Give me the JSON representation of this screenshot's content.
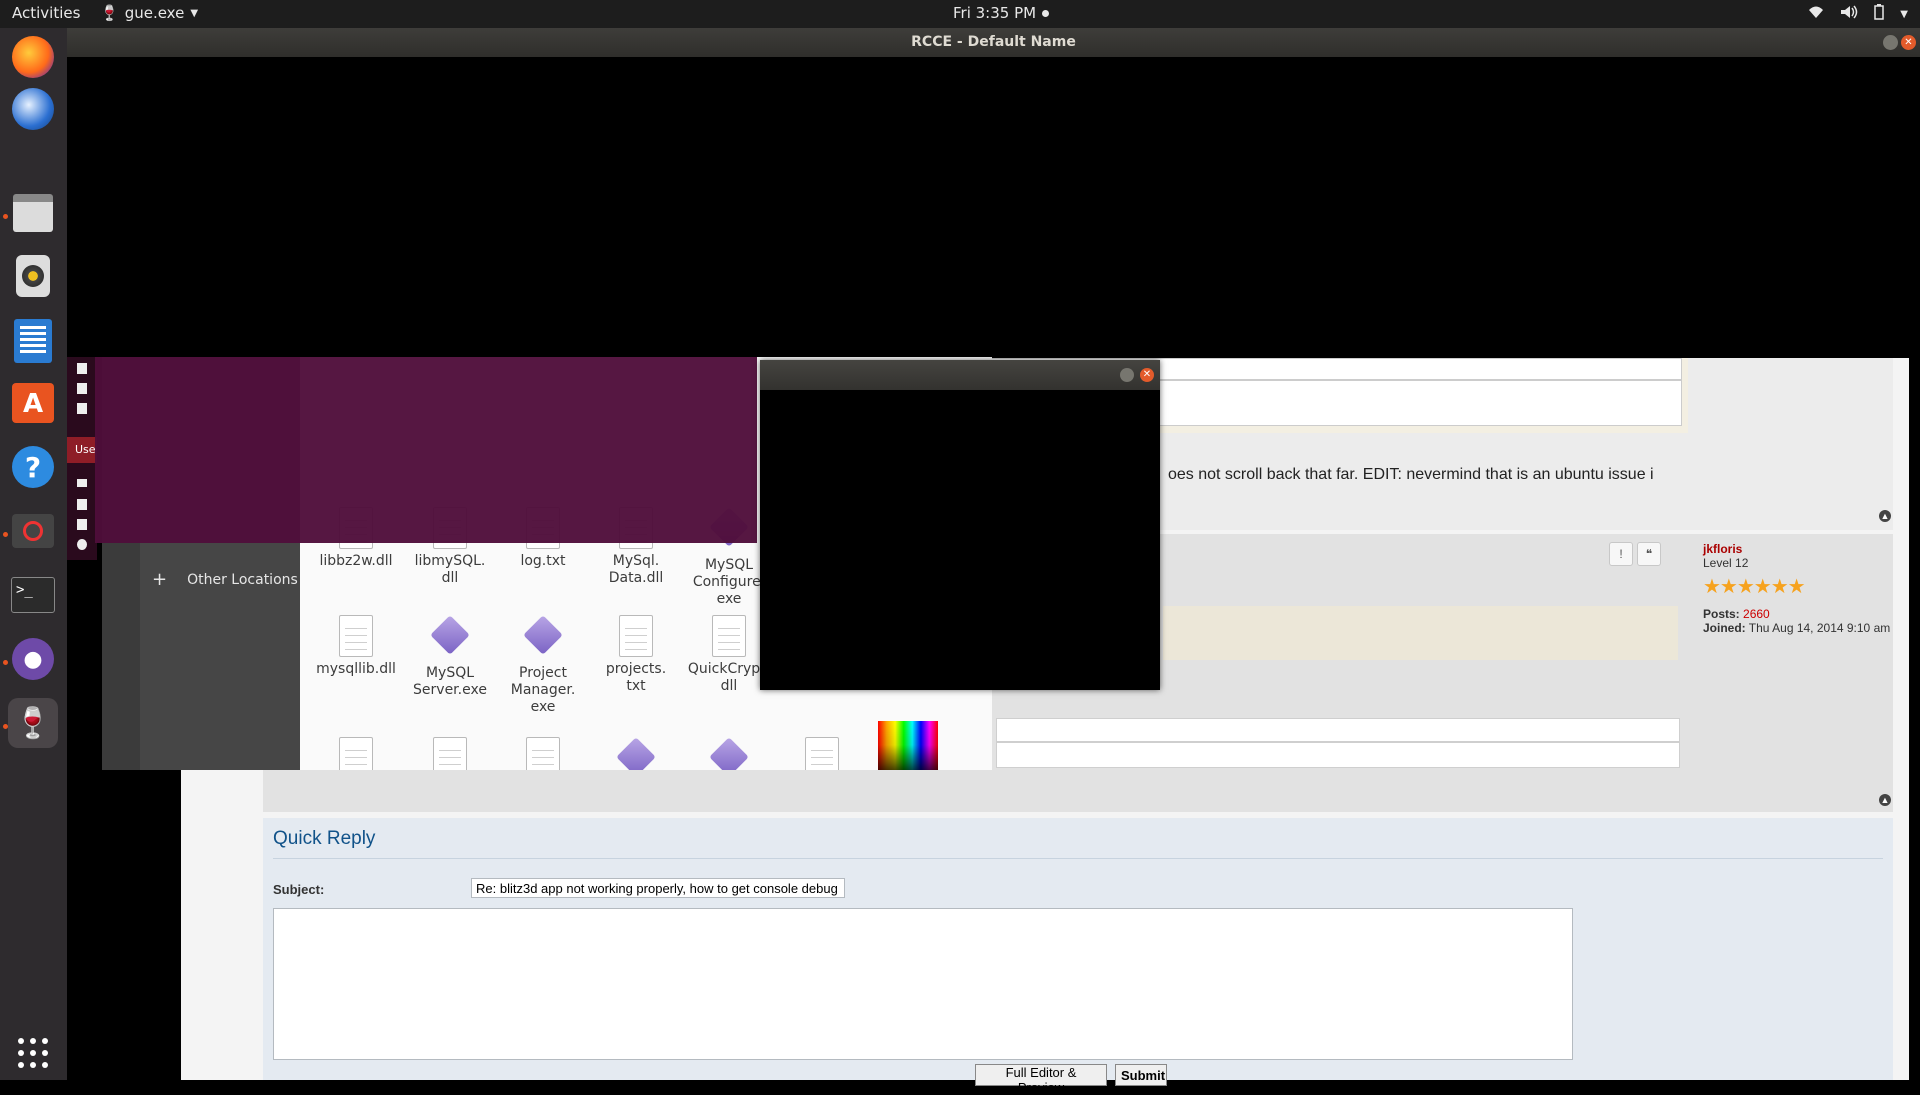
{
  "topbar": {
    "activities": "Activities",
    "app_name": "gue.exe",
    "clock": "Fri  3:35 PM"
  },
  "dock": {
    "items": [
      "firefox-icon",
      "thunderbird-icon",
      "files-icon",
      "rhythmbox-icon",
      "writer-icon",
      "software-icon",
      "help-icon",
      "blocked-icon",
      "terminal-icon",
      "github-icon",
      "wine-icon",
      "app-grid-icon"
    ]
  },
  "window": {
    "title": "RCCE - Default Name"
  },
  "forum": {
    "post1_text": "oes not scroll back that far. EDIT: nevermind that is an ubuntu issue i",
    "report_icon": "!",
    "quote_icon": "❝",
    "profile": {
      "username": "jkfloris",
      "rank": "Level 12",
      "posts_label": "Posts:",
      "posts": "2660",
      "joined_label": "Joined:",
      "joined": "Thu Aug 14, 2014 9:10 am"
    },
    "quick_reply": {
      "title": "Quick Reply",
      "subject_label": "Subject:",
      "subject_value": "Re: blitz3d app not working properly, how to get console debug",
      "full_editor_label": "Full Editor & Preview",
      "submit_label": "Submit"
    }
  },
  "file_manager": {
    "other_locations": "Other Locations",
    "use_tab": "Use",
    "files": [
      {
        "name": "libbz2w.dll",
        "kind": "doc"
      },
      {
        "name": "libmySQL.\ndll",
        "kind": "doc"
      },
      {
        "name": "log.txt",
        "kind": "doc"
      },
      {
        "name": "MySql.\nData.dll",
        "kind": "doc"
      },
      {
        "name": "MySQL\nConfigure.\nexe",
        "kind": "exe"
      },
      {
        "name": "mysqllib.dll",
        "kind": "doc"
      },
      {
        "name": "MySQL\nServer.exe",
        "kind": "exe"
      },
      {
        "name": "Project\nManager.\nexe",
        "kind": "exe"
      },
      {
        "name": "projects.\ntxt",
        "kind": "doc"
      },
      {
        "name": "QuickCrypt.\ndll",
        "kind": "doc"
      }
    ]
  }
}
